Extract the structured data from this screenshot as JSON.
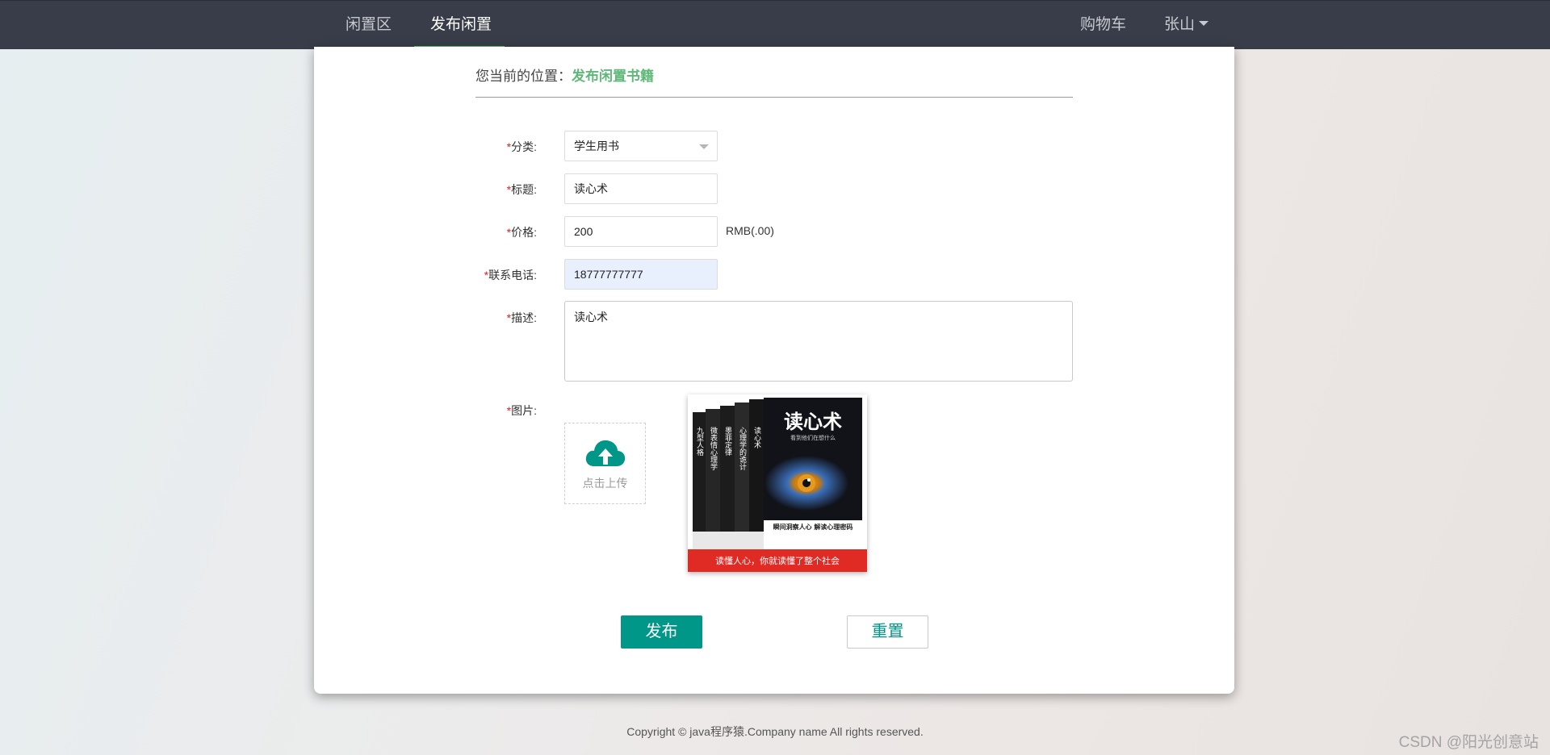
{
  "nav": {
    "items": [
      "闲置区",
      "发布闲置"
    ],
    "cart": "购物车",
    "user": "张山"
  },
  "breadcrumb": {
    "prefix": "您当前的位置：",
    "current": "发布闲置书籍"
  },
  "form": {
    "required_mark": "*",
    "category": {
      "label": "分类:",
      "value": "学生用书"
    },
    "title": {
      "label": "标题:",
      "value": "读心术"
    },
    "price": {
      "label": "价格:",
      "value": "200",
      "unit": "RMB(.00)"
    },
    "phone": {
      "label": "联系电话:",
      "value": "18777777777"
    },
    "description": {
      "label": "描述:",
      "value": "读心术"
    },
    "image": {
      "label": "图片:",
      "upload_text": "点击上传",
      "preview": {
        "title": "读心术",
        "subtitle": "看到他们在想什么",
        "spines": [
          "九型人格",
          "微表情心理学",
          "墨菲定律",
          "心理学的诡计",
          "读心术"
        ],
        "tagline": "瞬间洞察人心 解读心理密码",
        "banner": "读懂人心，你就读懂了整个社会"
      }
    },
    "submit": "发布",
    "reset": "重置"
  },
  "footer": "Copyright © java程序猿.Company name All rights reserved.",
  "watermark": "CSDN @阳光创意站",
  "colors": {
    "nav_bg": "#393d49",
    "accent": "#5fb878",
    "primary": "#009688",
    "required": "#e02020"
  }
}
